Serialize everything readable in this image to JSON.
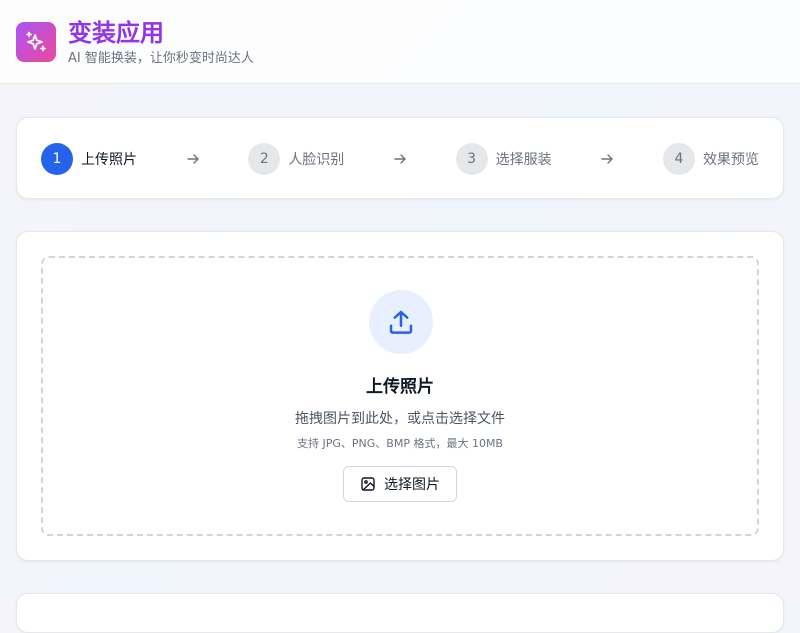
{
  "header": {
    "title": "变装应用",
    "subtitle": "AI 智能换装，让你秒变时尚达人",
    "logo_icon": "sparkles-icon"
  },
  "steps": [
    {
      "number": "1",
      "label": "上传照片",
      "active": true
    },
    {
      "number": "2",
      "label": "人脸识别",
      "active": false
    },
    {
      "number": "3",
      "label": "选择服装",
      "active": false
    },
    {
      "number": "4",
      "label": "效果预览",
      "active": false
    }
  ],
  "upload": {
    "title": "上传照片",
    "description": "拖拽图片到此处，或点击选择文件",
    "formats": "支持 JPG、PNG、BMP 格式，最大 10MB",
    "button_label": "选择图片",
    "icon": "upload-icon"
  },
  "colors": {
    "brand": "#9333ea",
    "accent": "#2563eb",
    "logo_gradient_start": "#a855f7",
    "logo_gradient_end": "#ec4899"
  }
}
